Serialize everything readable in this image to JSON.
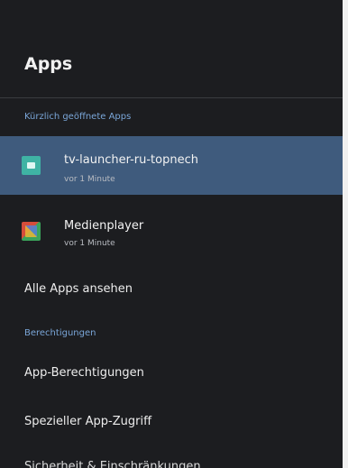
{
  "header": {
    "title": "Apps"
  },
  "recent": {
    "section_label": "Kürzlich geöffnete Apps",
    "apps": [
      {
        "name": "tv-launcher-ru-topnech",
        "time": "vor 1 Minute",
        "icon": "launcher-app-icon"
      },
      {
        "name": "Medienplayer",
        "time": "vor 1 Minute",
        "icon": "media-player-app-icon"
      }
    ],
    "see_all_label": "Alle Apps ansehen"
  },
  "permissions": {
    "section_label": "Berechtigungen",
    "items": [
      {
        "label": "App-Berechtigungen"
      },
      {
        "label": "Spezieller App-Zugriff"
      },
      {
        "label": "Sicherheit & Einschränkungen"
      }
    ]
  },
  "colors": {
    "background": "#1c1d20",
    "selected_row": "#3f5b7d",
    "section_label": "#7aa6d8",
    "primary_text": "#f2f2f2",
    "secondary_text": "#b9bcc2"
  }
}
